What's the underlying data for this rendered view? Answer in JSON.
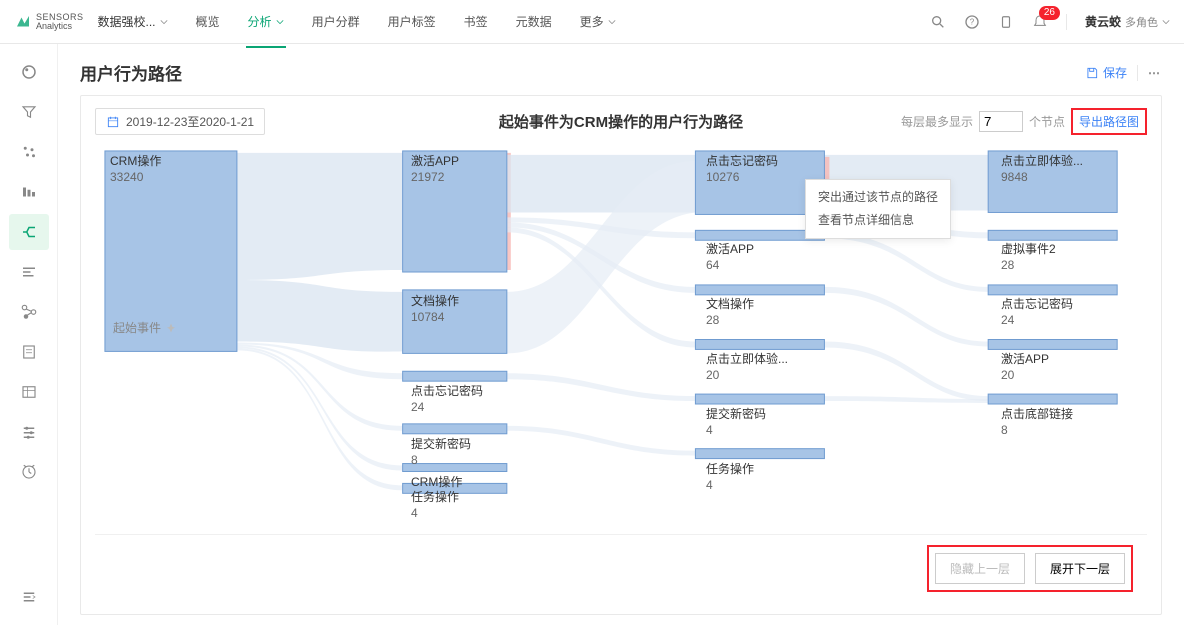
{
  "brand": {
    "line1": "SENSORS",
    "line2": "Analytics"
  },
  "project": {
    "name": "数据强校..."
  },
  "nav": {
    "items": [
      "概览",
      "分析",
      "用户分群",
      "用户标签",
      "书签",
      "元数据",
      "更多"
    ],
    "active_index": 1
  },
  "notifications": {
    "count": 26
  },
  "user": {
    "name": "黄云蛟",
    "role": "多角色"
  },
  "sidebar": {
    "items": [
      {
        "icon": "compass",
        "name": "overview"
      },
      {
        "icon": "funnel",
        "name": "funnel"
      },
      {
        "icon": "scatter",
        "name": "segmentation"
      },
      {
        "icon": "bar-stack",
        "name": "retention"
      },
      {
        "icon": "path",
        "name": "path",
        "active": true
      },
      {
        "icon": "bars-h",
        "name": "distribution"
      },
      {
        "icon": "branch",
        "name": "attribution"
      },
      {
        "icon": "doc",
        "name": "sql"
      },
      {
        "icon": "table",
        "name": "table"
      },
      {
        "icon": "slider",
        "name": "heatmap"
      },
      {
        "icon": "alarm",
        "name": "monitor"
      }
    ],
    "collapse": "collapse"
  },
  "page": {
    "title": "用户行为路径",
    "save_label": "保存",
    "date_range": "2019-12-23至2020-1-21",
    "chart_title": "起始事件为CRM操作的用户行为路径",
    "max_nodes_prefix": "每层最多显示",
    "max_nodes_value": "7",
    "max_nodes_suffix": "个节点",
    "export_label": "导出路径图",
    "start_event_label": "起始事件",
    "tooltip": {
      "line1": "突出通过该节点的路径",
      "line2": "查看节点详细信息"
    },
    "hide_prev_label": "隐藏上一层",
    "expand_next_label": "展开下一层"
  },
  "chart_data": {
    "type": "sankey",
    "columns": [
      [
        {
          "name": "CRM操作",
          "value": 33240
        }
      ],
      [
        {
          "name": "激活APP",
          "value": 21972
        },
        {
          "name": "文档操作",
          "value": 10784
        },
        {
          "name": "点击忘记密码",
          "value": 24
        },
        {
          "name": "提交新密码",
          "value": 8
        },
        {
          "name": "CRM操作",
          "value": 0
        },
        {
          "name": "任务操作",
          "value": 4
        }
      ],
      [
        {
          "name": "点击忘记密码",
          "value": 10276
        },
        {
          "name": "激活APP",
          "value": 64
        },
        {
          "name": "文档操作",
          "value": 28
        },
        {
          "name": "点击立即体验...",
          "value": 20
        },
        {
          "name": "提交新密码",
          "value": 4
        },
        {
          "name": "任务操作",
          "value": 4
        }
      ],
      [
        {
          "name": "点击立即体验...",
          "value": 9848
        },
        {
          "name": "虚拟事件2",
          "value": 28
        },
        {
          "name": "点击忘记密码",
          "value": 24
        },
        {
          "name": "激活APP",
          "value": 20
        },
        {
          "name": "点击底部链接",
          "value": 8
        }
      ]
    ]
  }
}
